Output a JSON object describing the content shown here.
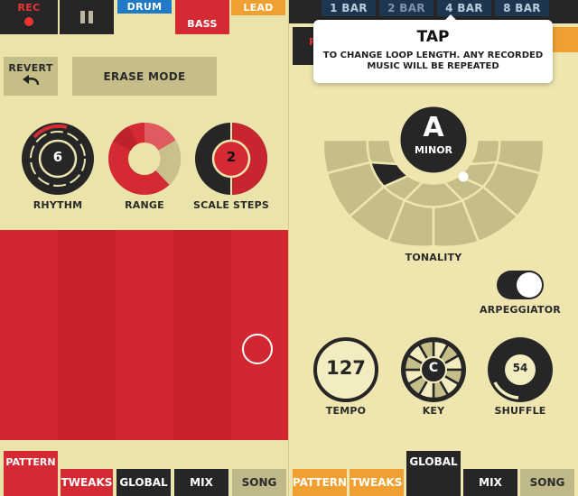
{
  "left": {
    "top": {
      "rec": "REC",
      "drum": "DRUM",
      "bass": "BASS",
      "lead": "LEAD"
    },
    "revert": "REVERT",
    "erase": "ERASE MODE",
    "rhythm": {
      "label": "RHYTHM",
      "value": "6"
    },
    "range": {
      "label": "RANGE"
    },
    "scale": {
      "label": "SCALE STEPS",
      "value": "2"
    },
    "tabs": [
      "PATTERN",
      "TWEAKS",
      "GLOBAL",
      "MIX",
      "SONG"
    ]
  },
  "right": {
    "bars": [
      "1 BAR",
      "2 BAR",
      "4 BAR",
      "8 BAR"
    ],
    "tooltip": {
      "title": "TAP",
      "body1": "TO CHANGE LOOP LENGTH. ANY RECORDED",
      "body2": "MUSIC WILL BE REPEATED"
    },
    "tonality": {
      "note": "A",
      "mode": "MINOR",
      "label": "TONALITY"
    },
    "arpeggiator": {
      "label": "ARPEGGIATOR",
      "on": true
    },
    "tempo": {
      "value": "127",
      "label": "TEMPO"
    },
    "key": {
      "value": "C",
      "label": "KEY"
    },
    "shuffle": {
      "value": "54",
      "label": "SHUFFLE"
    },
    "tabs": [
      "PATTERN",
      "TWEAKS",
      "GLOBAL",
      "MIX",
      "SONG"
    ]
  },
  "colors": {
    "red": "#d42a33",
    "dark": "#262626",
    "bg": "#ece5ad",
    "orange": "#f0a030",
    "blue": "#1f79c4",
    "olive": "#bfb889"
  }
}
